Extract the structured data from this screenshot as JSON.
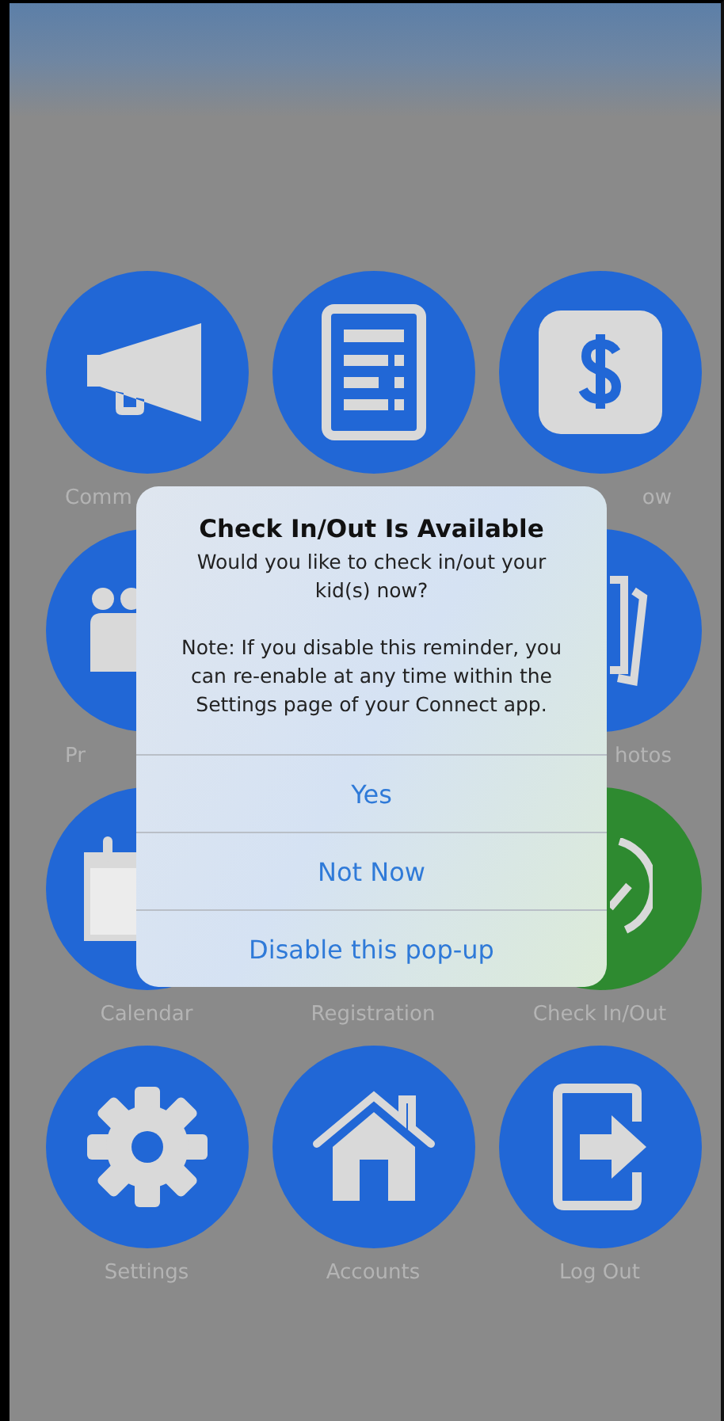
{
  "tiles": [
    {
      "kind": "megaphone",
      "label": "Comm",
      "partly_hidden": true,
      "color": "#2167d6"
    },
    {
      "kind": "document",
      "color": "#2167d6"
    },
    {
      "kind": "dollar",
      "label": "ow",
      "partly_hidden": true,
      "color": "#2167d6"
    },
    {
      "kind": "people",
      "label": "Pr",
      "partly_hidden": true,
      "color": "#2167d6"
    },
    {
      "kind": "photos",
      "label": "hotos",
      "partly_hidden": true,
      "color": "#2167d6"
    },
    {
      "kind": "calendar",
      "label": "Calendar",
      "partly_hidden": false,
      "color": "#2167d6"
    },
    {
      "label": "Registration"
    },
    {
      "kind": "check",
      "label": "Check In/Out",
      "partly_hidden": false,
      "color": "#2e8a30"
    },
    {
      "kind": "gear",
      "label": "Settings",
      "partly_hidden": false,
      "color": "#2167d6"
    },
    {
      "kind": "house",
      "label": "Accounts",
      "color": "#2167d6"
    },
    {
      "kind": "logout",
      "label": "Log Out",
      "partly_hidden": false,
      "color": "#2167d6"
    }
  ],
  "dialog": {
    "title": "Check In/Out Is Available",
    "message": "Would you like to check in/out your kid(s) now?",
    "note": "Note: If you disable this reminder, you can re-enable at any time within the Settings page of your Connect app.",
    "buttons": [
      "Yes",
      "Not Now",
      "Disable this pop-up"
    ]
  }
}
